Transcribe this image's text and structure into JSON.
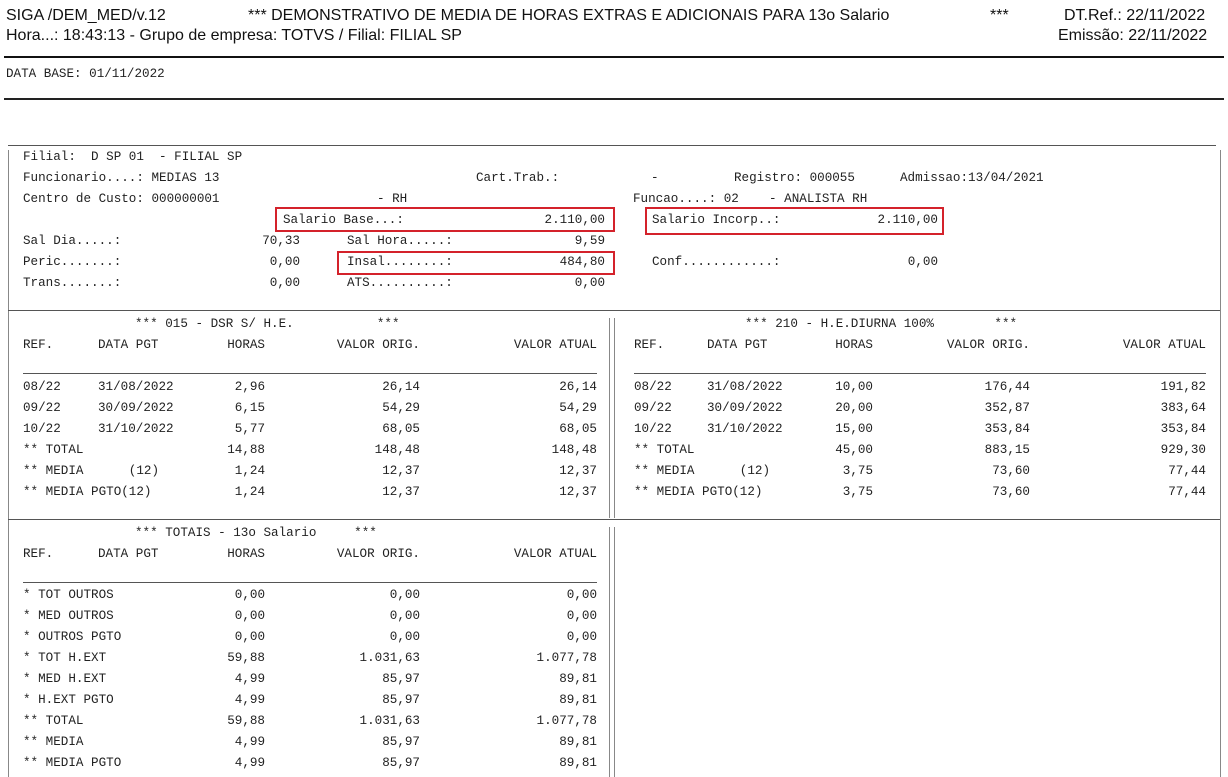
{
  "header": {
    "program": "SIGA /DEM_MED/v.12",
    "title": "*** DEMONSTRATIVO DE MEDIA DE HORAS EXTRAS E ADICIONAIS PARA 13o Salario",
    "title_stars": "***",
    "dt_ref": "DT.Ref.: 22/11/2022",
    "line2_left": "Hora...: 18:43:13 - Grupo de empresa: TOTVS / Filial: FILIAL SP",
    "emissao": "Emissão: 22/11/2022",
    "data_base": "DATA BASE: 01/11/2022"
  },
  "employee": {
    "filial": "Filial:  D SP 01  - FILIAL SP",
    "funcionario": "Funcionario....: MEDIAS 13",
    "cart_trab": "Cart.Trab.:",
    "cart_dash": "-",
    "registro": "Registro: 000055",
    "admissao": "Admissao:13/04/2021",
    "centro_custo": "Centro de Custo: 000000001",
    "centro_desc": "- RH",
    "funcao": "Funcao....: 02    - ANALISTA RH",
    "salario_base_label": "Salario Base...:",
    "salario_base_value": "2.110,00",
    "salario_incorp_label": "Salario Incorp..:",
    "salario_incorp_value": "2.110,00",
    "sal_dia_label": "Sal Dia.....:",
    "sal_dia_value": "70,33",
    "sal_hora_label": "Sal Hora.....:",
    "sal_hora_value": "9,59",
    "peric_label": "Peric.......:",
    "peric_value": "0,00",
    "insal_label": "Insal........:",
    "insal_value": "484,80",
    "conf_label": "Conf............:",
    "conf_value": "0,00",
    "trans_label": "Trans.......:",
    "trans_value": "0,00",
    "ats_label": "ATS..........:",
    "ats_value": "0,00"
  },
  "col_headers": {
    "ref": "REF.",
    "data_pgt": "DATA PGT",
    "horas": "HORAS",
    "valor_orig": "VALOR ORIG.",
    "valor_atual": "VALOR ATUAL"
  },
  "section_015": {
    "title": "*** 015 - DSR S/ H.E.           ***",
    "rows": [
      {
        "ref": "08/22",
        "data": "31/08/2022",
        "horas": "2,96",
        "orig": "26,14",
        "atual": "26,14"
      },
      {
        "ref": "09/22",
        "data": "30/09/2022",
        "horas": "6,15",
        "orig": "54,29",
        "atual": "54,29"
      },
      {
        "ref": "10/22",
        "data": "31/10/2022",
        "horas": "5,77",
        "orig": "68,05",
        "atual": "68,05"
      },
      {
        "ref": "** TOTAL",
        "data": "",
        "horas": "14,88",
        "orig": "148,48",
        "atual": "148,48"
      },
      {
        "ref": "** MEDIA      (12)",
        "data": "",
        "horas": "1,24",
        "orig": "12,37",
        "atual": "12,37"
      },
      {
        "ref": "** MEDIA PGTO(12)",
        "data": "",
        "horas": "1,24",
        "orig": "12,37",
        "atual": "12,37"
      }
    ]
  },
  "section_210": {
    "title": "*** 210 - H.E.DIURNA 100%        ***",
    "rows": [
      {
        "ref": "08/22",
        "data": "31/08/2022",
        "horas": "10,00",
        "orig": "176,44",
        "atual": "191,82"
      },
      {
        "ref": "09/22",
        "data": "30/09/2022",
        "horas": "20,00",
        "orig": "352,87",
        "atual": "383,64"
      },
      {
        "ref": "10/22",
        "data": "31/10/2022",
        "horas": "15,00",
        "orig": "353,84",
        "atual": "353,84"
      },
      {
        "ref": "** TOTAL",
        "data": "",
        "horas": "45,00",
        "orig": "883,15",
        "atual": "929,30"
      },
      {
        "ref": "** MEDIA      (12)",
        "data": "",
        "horas": "3,75",
        "orig": "73,60",
        "atual": "77,44"
      },
      {
        "ref": "** MEDIA PGTO(12)",
        "data": "",
        "horas": "3,75",
        "orig": "73,60",
        "atual": "77,44"
      }
    ]
  },
  "section_totais": {
    "title": "*** TOTAIS - 13o Salario     ***",
    "rows": [
      {
        "ref": "* TOT OUTROS",
        "horas": "0,00",
        "orig": "0,00",
        "atual": "0,00"
      },
      {
        "ref": "* MED OUTROS",
        "horas": "0,00",
        "orig": "0,00",
        "atual": "0,00"
      },
      {
        "ref": "* OUTROS PGTO",
        "horas": "0,00",
        "orig": "0,00",
        "atual": "0,00"
      },
      {
        "ref": "* TOT H.EXT",
        "horas": "59,88",
        "orig": "1.031,63",
        "atual": "1.077,78"
      },
      {
        "ref": "* MED H.EXT",
        "horas": "4,99",
        "orig": "85,97",
        "atual": "89,81"
      },
      {
        "ref": "* H.EXT PGTO",
        "horas": "4,99",
        "orig": "85,97",
        "atual": "89,81"
      },
      {
        "ref": "** TOTAL",
        "horas": "59,88",
        "orig": "1.031,63",
        "atual": "1.077,78"
      },
      {
        "ref": "** MEDIA",
        "horas": "4,99",
        "orig": "85,97",
        "atual": "89,81"
      },
      {
        "ref": "** MEDIA PGTO",
        "horas": "4,99",
        "orig": "85,97",
        "atual": "89,81"
      }
    ]
  }
}
